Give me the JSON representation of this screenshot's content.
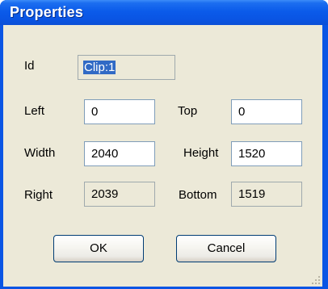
{
  "window": {
    "title": "Properties"
  },
  "form": {
    "id_label": "Id",
    "id_value": "Clip:1",
    "left_label": "Left",
    "left_value": "0",
    "top_label": "Top",
    "top_value": "0",
    "width_label": "Width",
    "width_value": "2040",
    "height_label": "Height",
    "height_value": "1520",
    "right_label": "Right",
    "right_value": "2039",
    "bottom_label": "Bottom",
    "bottom_value": "1519"
  },
  "buttons": {
    "ok_label": "OK",
    "cancel_label": "Cancel"
  },
  "icons": {
    "resize": "resize-grip-icon"
  },
  "colors": {
    "titlebar": "#0a55e4",
    "client": "#ece9d8",
    "selection": "#316ac5"
  }
}
